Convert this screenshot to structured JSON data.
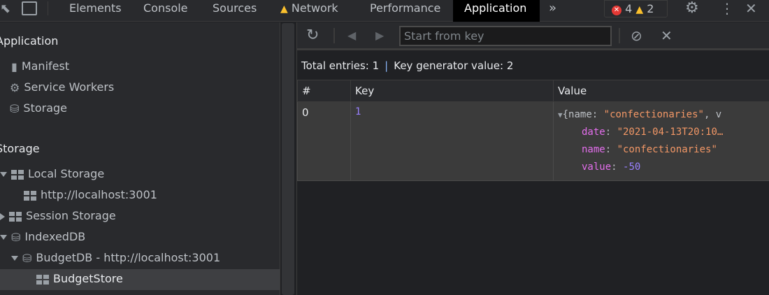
{
  "tabs": [
    "Elements",
    "Console",
    "Sources",
    "Network",
    "Performance",
    "Application"
  ],
  "active_tab": "Application",
  "badges": {
    "errors": "4",
    "warnings": "2"
  },
  "sidebar": {
    "section1": "Application",
    "app_items": [
      "Manifest",
      "Service Workers",
      "Storage"
    ],
    "section2": "Storage",
    "local_storage": "Local Storage",
    "local_origin": "http://localhost:3001",
    "session_storage": "Session Storage",
    "indexeddb": "IndexedDB",
    "db": "BudgetDB - http://localhost:3001",
    "store": "BudgetStore"
  },
  "toolbar": {
    "search_placeholder": "Start from key"
  },
  "totals": {
    "entries": "Total entries: 1",
    "keygen": "Key generator value: 2"
  },
  "table": {
    "headers": [
      "#",
      "Key",
      "Value"
    ],
    "rows": [
      {
        "index": "0",
        "key": "1",
        "preview_open": "{name: ",
        "preview_name": "\"confectionaries\"",
        "preview_rest": ", v",
        "props": [
          {
            "k": "date",
            "v": "\"2021-04-13T20:10…"
          },
          {
            "k": "name",
            "v": "\"confectionaries\""
          },
          {
            "k": "value",
            "v": "-50"
          }
        ]
      }
    ]
  },
  "colors": {
    "accent": "#8ab4f8",
    "string": "#f29766",
    "key": "#e36eec",
    "number": "#9980ff"
  }
}
